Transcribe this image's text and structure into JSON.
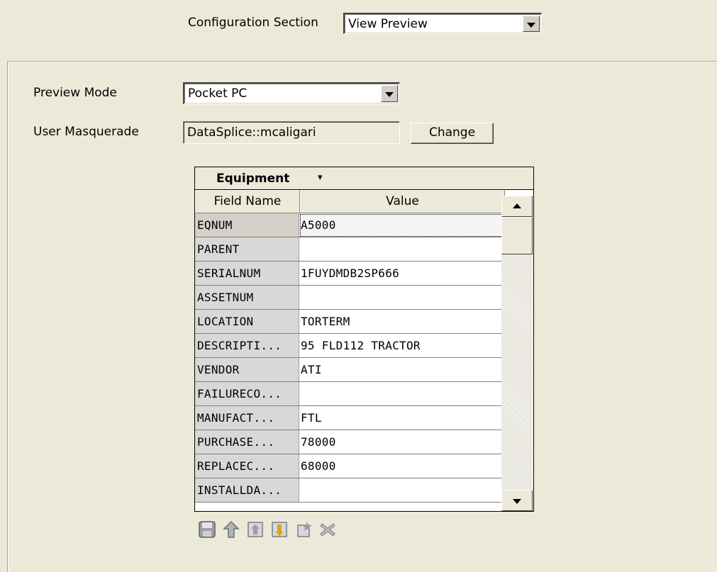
{
  "config": {
    "label": "Configuration Section",
    "selected": "View Preview"
  },
  "preview": {
    "mode_label": "Preview Mode",
    "mode_value": "Pocket PC",
    "user_label": "User Masquerade",
    "user_value": "DataSplice::mcaligari",
    "change_button": "Change"
  },
  "grid": {
    "title": "Equipment",
    "title_caret": "▾",
    "col_name": "Field Name",
    "col_value": "Value",
    "rows": [
      {
        "name": "EQNUM",
        "value": "A5000"
      },
      {
        "name": "PARENT",
        "value": ""
      },
      {
        "name": "SERIALNUM",
        "value": "1FUYDMDB2SP666"
      },
      {
        "name": "ASSETNUM",
        "value": ""
      },
      {
        "name": "LOCATION",
        "value": "TORTERM"
      },
      {
        "name": "DESCRIPTI...",
        "value": "95 FLD112 TRACTOR"
      },
      {
        "name": "VENDOR",
        "value": "ATI"
      },
      {
        "name": "FAILURECO...",
        "value": ""
      },
      {
        "name": "MANUFACT...",
        "value": "FTL"
      },
      {
        "name": "PURCHASE...",
        "value": "78000"
      },
      {
        "name": "REPLACEC...",
        "value": "68000"
      },
      {
        "name": "INSTALLDA...",
        "value": ""
      }
    ]
  },
  "toolbar": {
    "icons": [
      "save-icon",
      "up-arrow-icon",
      "move-first-icon",
      "move-last-icon",
      "new-record-icon",
      "delete-icon"
    ]
  }
}
